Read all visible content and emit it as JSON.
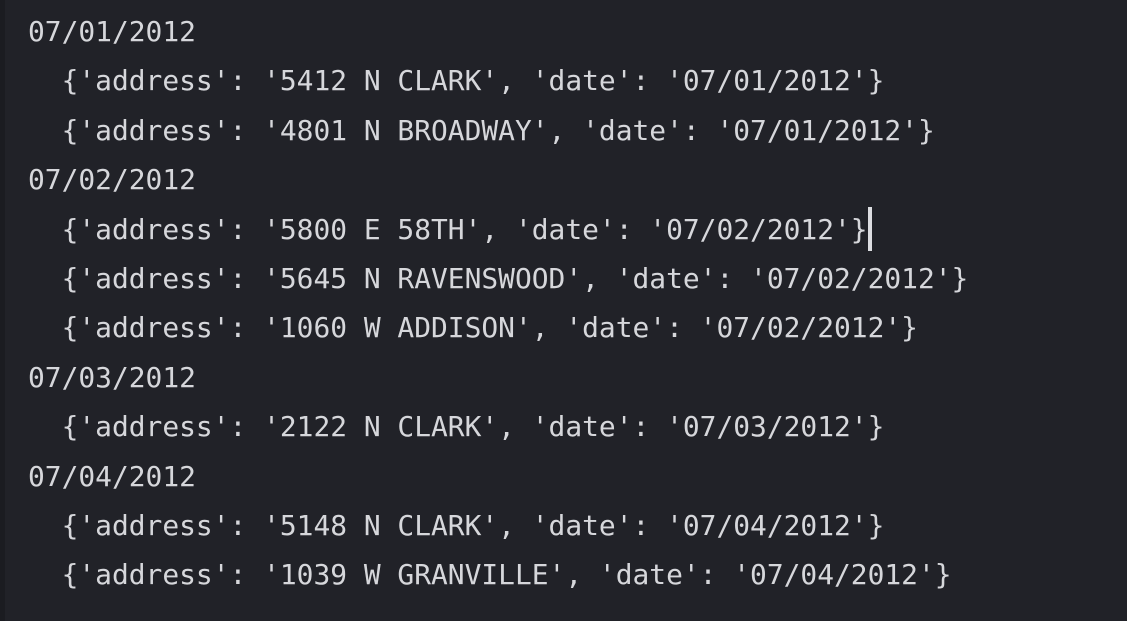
{
  "terminal": {
    "background_color": "#212228",
    "text_color": "#d6d7db",
    "caret_color": "#dcdde1",
    "font_size_px": 28,
    "line_height_px": 49,
    "indent_spaces": 2
  },
  "output": {
    "lines": [
      {
        "kind": "group-header",
        "indent": 0,
        "text": "07/01/2012",
        "caret": false
      },
      {
        "kind": "record",
        "indent": 2,
        "text": "{'address': '5412 N CLARK', 'date': '07/01/2012'}",
        "caret": false
      },
      {
        "kind": "record",
        "indent": 2,
        "text": "{'address': '4801 N BROADWAY', 'date': '07/01/2012'}",
        "caret": false
      },
      {
        "kind": "group-header",
        "indent": 0,
        "text": "07/02/2012",
        "caret": false
      },
      {
        "kind": "record",
        "indent": 2,
        "text": "{'address': '5800 E 58TH', 'date': '07/02/2012'}",
        "caret": true
      },
      {
        "kind": "record",
        "indent": 2,
        "text": "{'address': '5645 N RAVENSWOOD', 'date': '07/02/2012'}",
        "caret": false
      },
      {
        "kind": "record",
        "indent": 2,
        "text": "{'address': '1060 W ADDISON', 'date': '07/02/2012'}",
        "caret": false
      },
      {
        "kind": "group-header",
        "indent": 0,
        "text": "07/03/2012",
        "caret": false
      },
      {
        "kind": "record",
        "indent": 2,
        "text": "{'address': '2122 N CLARK', 'date': '07/03/2012'}",
        "caret": false
      },
      {
        "kind": "group-header",
        "indent": 0,
        "text": "07/04/2012",
        "caret": false
      },
      {
        "kind": "record",
        "indent": 2,
        "text": "{'address': '5148 N CLARK', 'date': '07/04/2012'}",
        "caret": false
      },
      {
        "kind": "record",
        "indent": 2,
        "text": "{'address': '1039 W GRANVILLE', 'date': '07/04/2012'}",
        "caret": false
      }
    ],
    "groups": [
      {
        "date": "07/01/2012",
        "records": [
          {
            "address": "5412 N CLARK",
            "date": "07/01/2012"
          },
          {
            "address": "4801 N BROADWAY",
            "date": "07/01/2012"
          }
        ]
      },
      {
        "date": "07/02/2012",
        "records": [
          {
            "address": "5800 E 58TH",
            "date": "07/02/2012"
          },
          {
            "address": "5645 N RAVENSWOOD",
            "date": "07/02/2012"
          },
          {
            "address": "1060 W ADDISON",
            "date": "07/02/2012"
          }
        ]
      },
      {
        "date": "07/03/2012",
        "records": [
          {
            "address": "2122 N CLARK",
            "date": "07/03/2012"
          }
        ]
      },
      {
        "date": "07/04/2012",
        "records": [
          {
            "address": "5148 N CLARK",
            "date": "07/04/2012"
          },
          {
            "address": "1039 W GRANVILLE",
            "date": "07/04/2012"
          }
        ]
      }
    ]
  }
}
